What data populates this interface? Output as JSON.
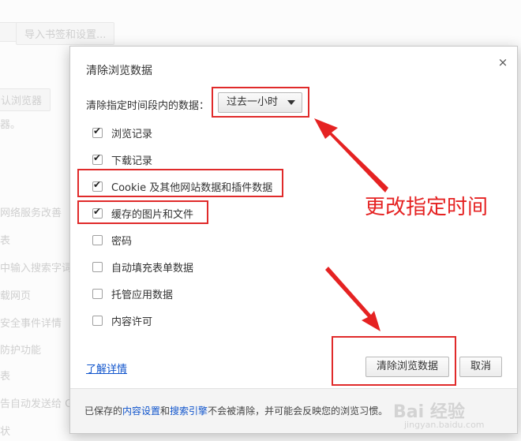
{
  "background": {
    "items": [
      {
        "text": "导入书签和设置...",
        "kind": "button"
      },
      {
        "text": "认浏览器",
        "kind": "button"
      },
      {
        "text": "器。",
        "kind": "text"
      },
      {
        "text": "网络服务改善",
        "kind": "text"
      },
      {
        "text": "表",
        "kind": "text"
      },
      {
        "text": "中输入搜索字词",
        "kind": "text"
      },
      {
        "text": "载网页",
        "kind": "text"
      },
      {
        "text": "安全事件详情",
        "kind": "text"
      },
      {
        "text": "防护功能",
        "kind": "text"
      },
      {
        "text": "表",
        "kind": "text"
      },
      {
        "text": "告自动发送给 G",
        "kind": "text"
      },
      {
        "text": "状",
        "kind": "text"
      }
    ]
  },
  "dialog": {
    "title": "清除浏览数据",
    "close_symbol": "×",
    "range_label": "清除指定时间段内的数据：",
    "range_value": "过去一小时",
    "options": [
      {
        "label": "浏览记录",
        "checked": true
      },
      {
        "label": "下载记录",
        "checked": true
      },
      {
        "label": "Cookie 及其他网站数据和插件数据",
        "checked": true
      },
      {
        "label": "缓存的图片和文件",
        "checked": true
      },
      {
        "label": "密码",
        "checked": false
      },
      {
        "label": "自动填充表单数据",
        "checked": false
      },
      {
        "label": "托管应用数据",
        "checked": false
      },
      {
        "label": "内容许可",
        "checked": false
      }
    ],
    "learn_more": "了解详情",
    "clear_button": "清除浏览数据",
    "cancel_button": "取消",
    "footer": {
      "prefix": "已保存的",
      "link1": "内容设置",
      "mid": "和",
      "link2": "搜索引擎",
      "suffix": "不会被清除，并可能会反映您的浏览习惯。"
    }
  },
  "annotation": {
    "text": "更改指定时间",
    "color": "#e52222"
  },
  "watermark": {
    "text": "Bai 经验",
    "sub": "jingyan.baidu.com"
  }
}
